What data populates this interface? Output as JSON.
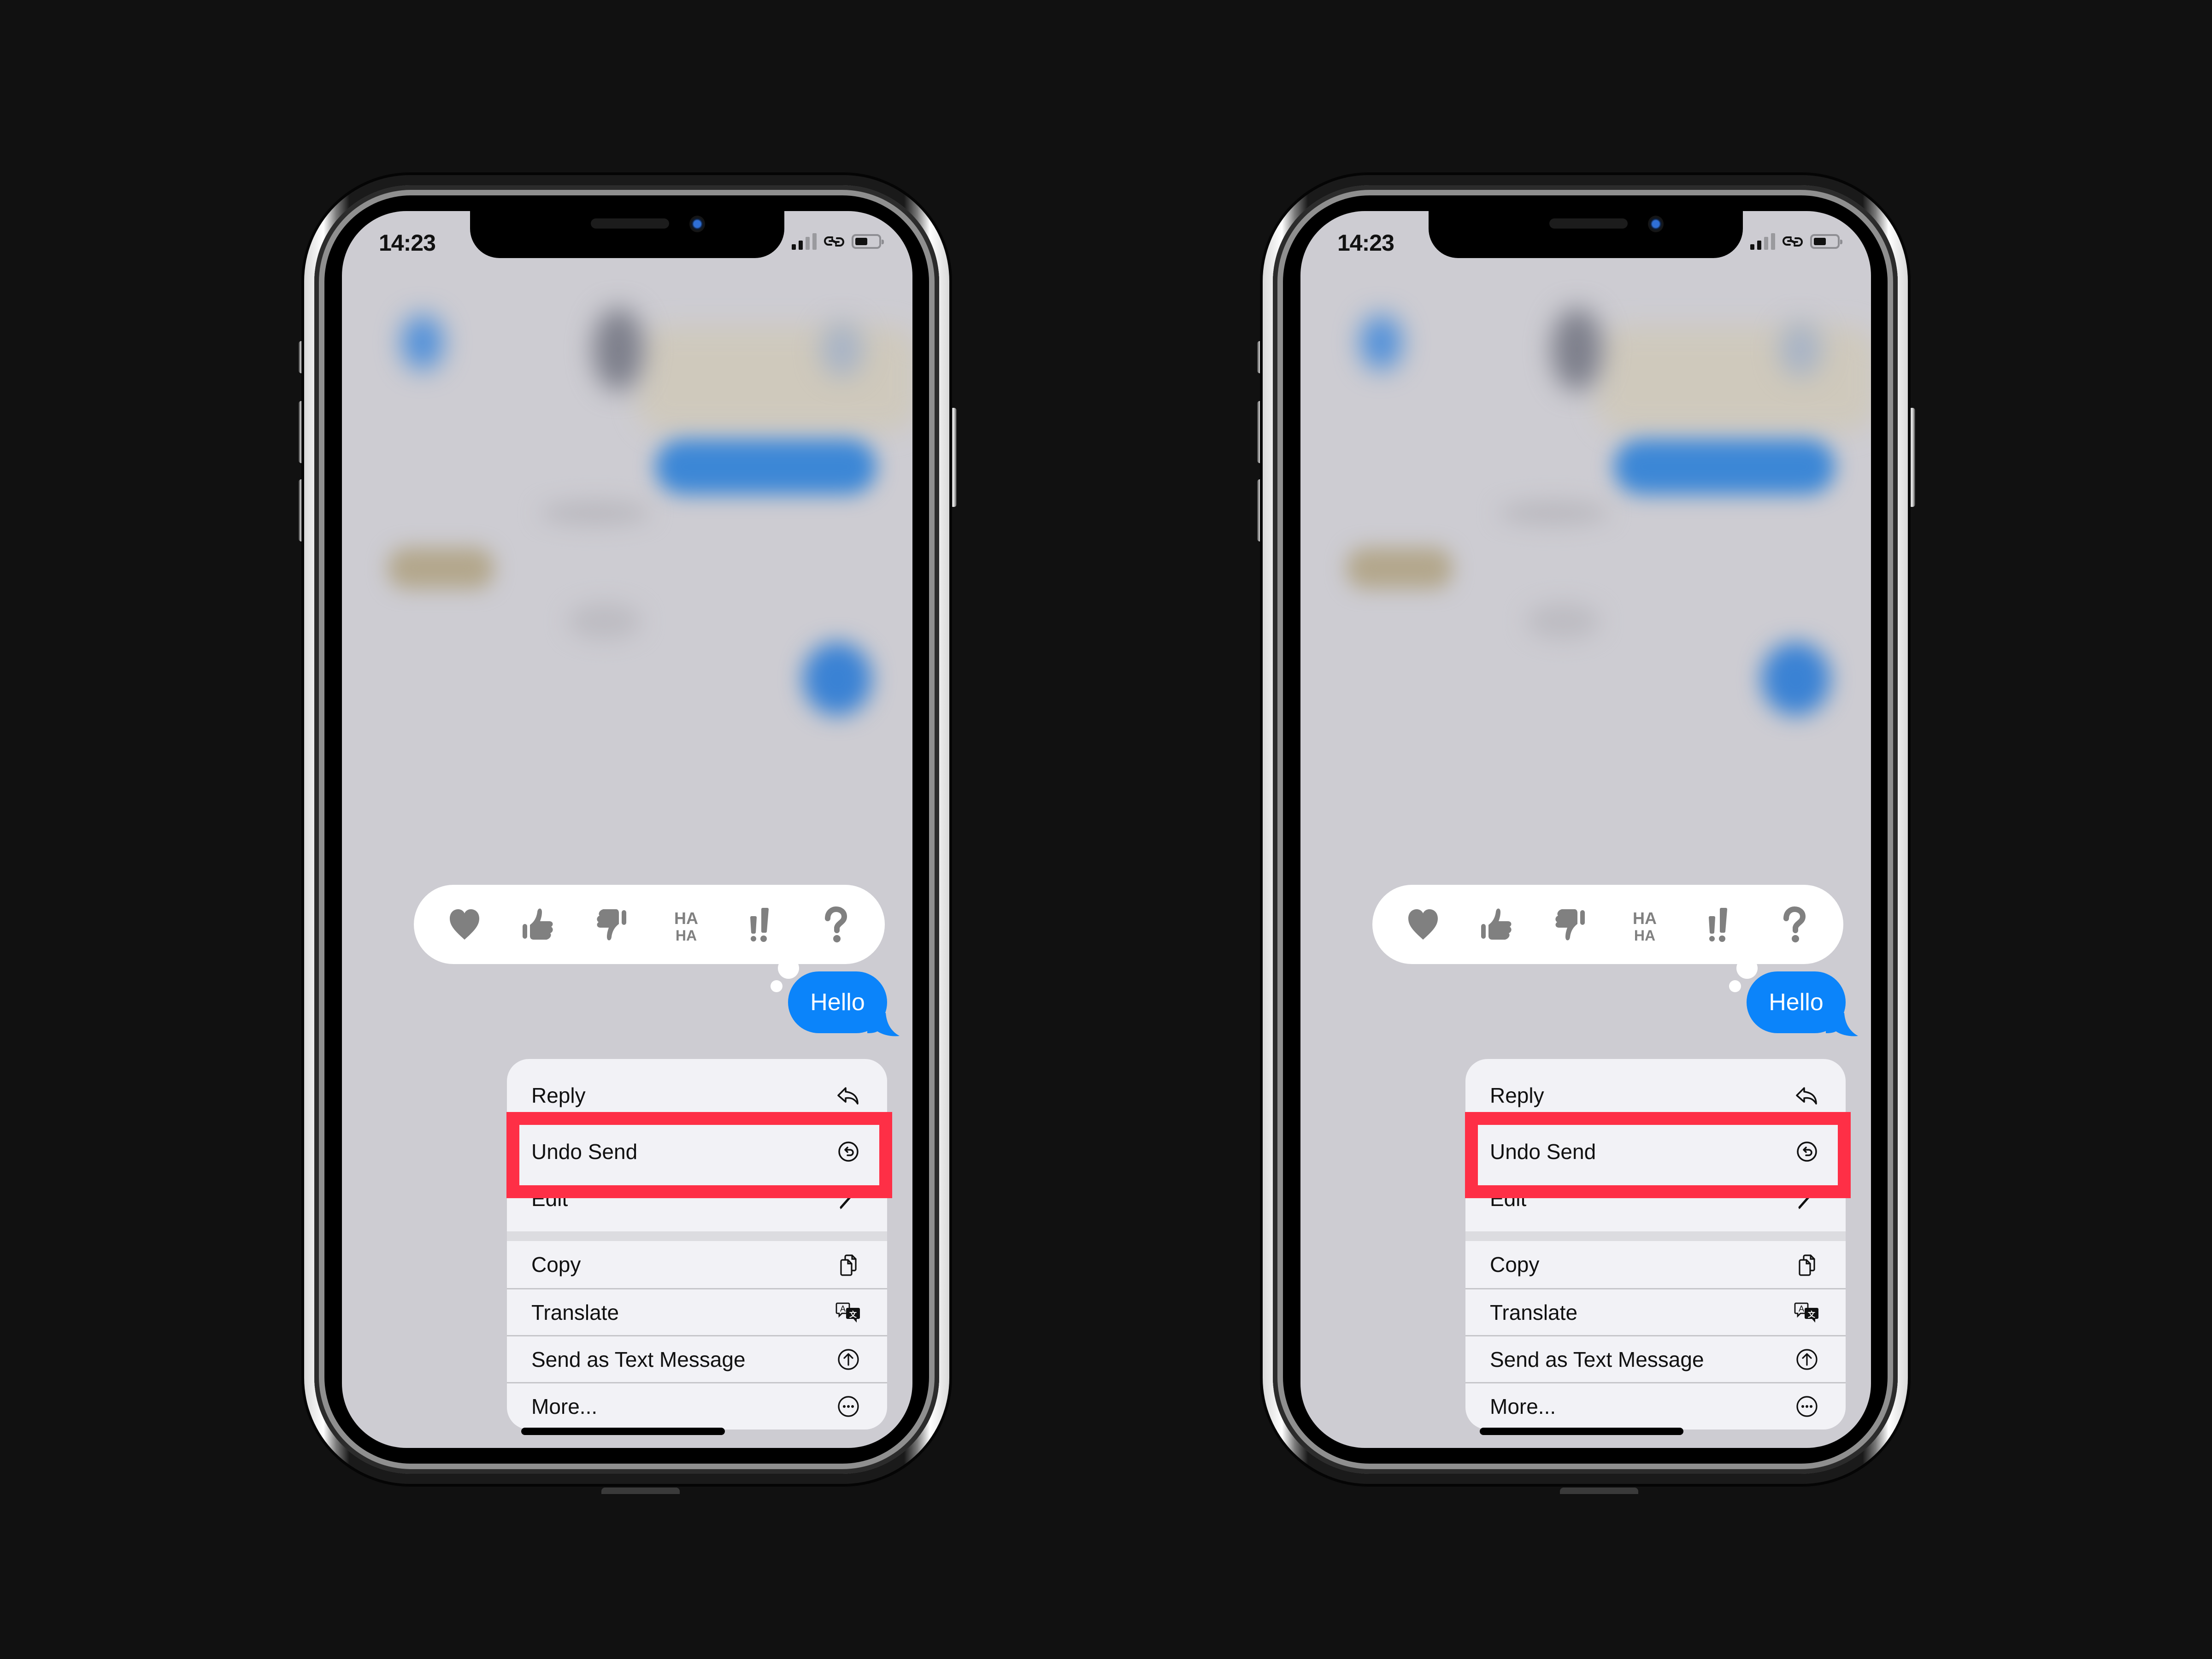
{
  "colors": {
    "page_background": "#111111",
    "highlight": "#fe2f46",
    "bubble": "#0b84fa",
    "reaction_icon": "#808080"
  },
  "phones": [
    {
      "status_bar": {
        "time": "14:23",
        "signal_bars_active": 2,
        "signal_bars_total": 4,
        "battery_level_fraction": 0.55,
        "icons": [
          "cellular-signal-icon",
          "personal-hotspot-link-icon",
          "battery-icon"
        ]
      },
      "reactions": [
        {
          "name": "heart",
          "icon": "heart-icon"
        },
        {
          "name": "thumbs-up",
          "icon": "thumbs-up-icon"
        },
        {
          "name": "thumbs-down",
          "icon": "thumbs-down-icon"
        },
        {
          "name": "haha",
          "icon": "haha-icon",
          "text_top": "HA",
          "text_bottom": "HA"
        },
        {
          "name": "emphasize",
          "icon": "double-exclamation-icon",
          "text": "‼"
        },
        {
          "name": "question",
          "icon": "question-mark-icon",
          "text": "?"
        }
      ],
      "message": {
        "text": "Hello"
      },
      "menu": {
        "items": [
          {
            "label": "Reply",
            "icon": "reply-arrow-icon"
          },
          {
            "label": "Undo Send",
            "icon": "undo-circle-icon",
            "highlighted": true
          },
          {
            "label": "Edit",
            "icon": "pencil-icon"
          },
          {
            "label": "Copy",
            "icon": "copy-documents-icon"
          },
          {
            "label": "Translate",
            "icon": "translate-bubbles-icon"
          },
          {
            "label": "Send as Text Message",
            "icon": "arrow-up-circle-icon"
          },
          {
            "label": "More...",
            "icon": "ellipsis-circle-icon"
          }
        ]
      }
    },
    {
      "status_bar": {
        "time": "14:23",
        "signal_bars_active": 2,
        "signal_bars_total": 4,
        "battery_level_fraction": 0.55,
        "icons": [
          "cellular-signal-icon",
          "personal-hotspot-link-icon",
          "battery-icon"
        ]
      },
      "reactions": [
        {
          "name": "heart",
          "icon": "heart-icon"
        },
        {
          "name": "thumbs-up",
          "icon": "thumbs-up-icon"
        },
        {
          "name": "thumbs-down",
          "icon": "thumbs-down-icon"
        },
        {
          "name": "haha",
          "icon": "haha-icon",
          "text_top": "HA",
          "text_bottom": "HA"
        },
        {
          "name": "emphasize",
          "icon": "double-exclamation-icon",
          "text": "‼"
        },
        {
          "name": "question",
          "icon": "question-mark-icon",
          "text": "?"
        }
      ],
      "message": {
        "text": "Hello"
      },
      "menu": {
        "items": [
          {
            "label": "Reply",
            "icon": "reply-arrow-icon"
          },
          {
            "label": "Undo Send",
            "icon": "undo-circle-icon",
            "highlighted": true
          },
          {
            "label": "Edit",
            "icon": "pencil-icon"
          },
          {
            "label": "Copy",
            "icon": "copy-documents-icon"
          },
          {
            "label": "Translate",
            "icon": "translate-bubbles-icon"
          },
          {
            "label": "Send as Text Message",
            "icon": "arrow-up-circle-icon"
          },
          {
            "label": "More...",
            "icon": "ellipsis-circle-icon"
          }
        ]
      }
    }
  ]
}
